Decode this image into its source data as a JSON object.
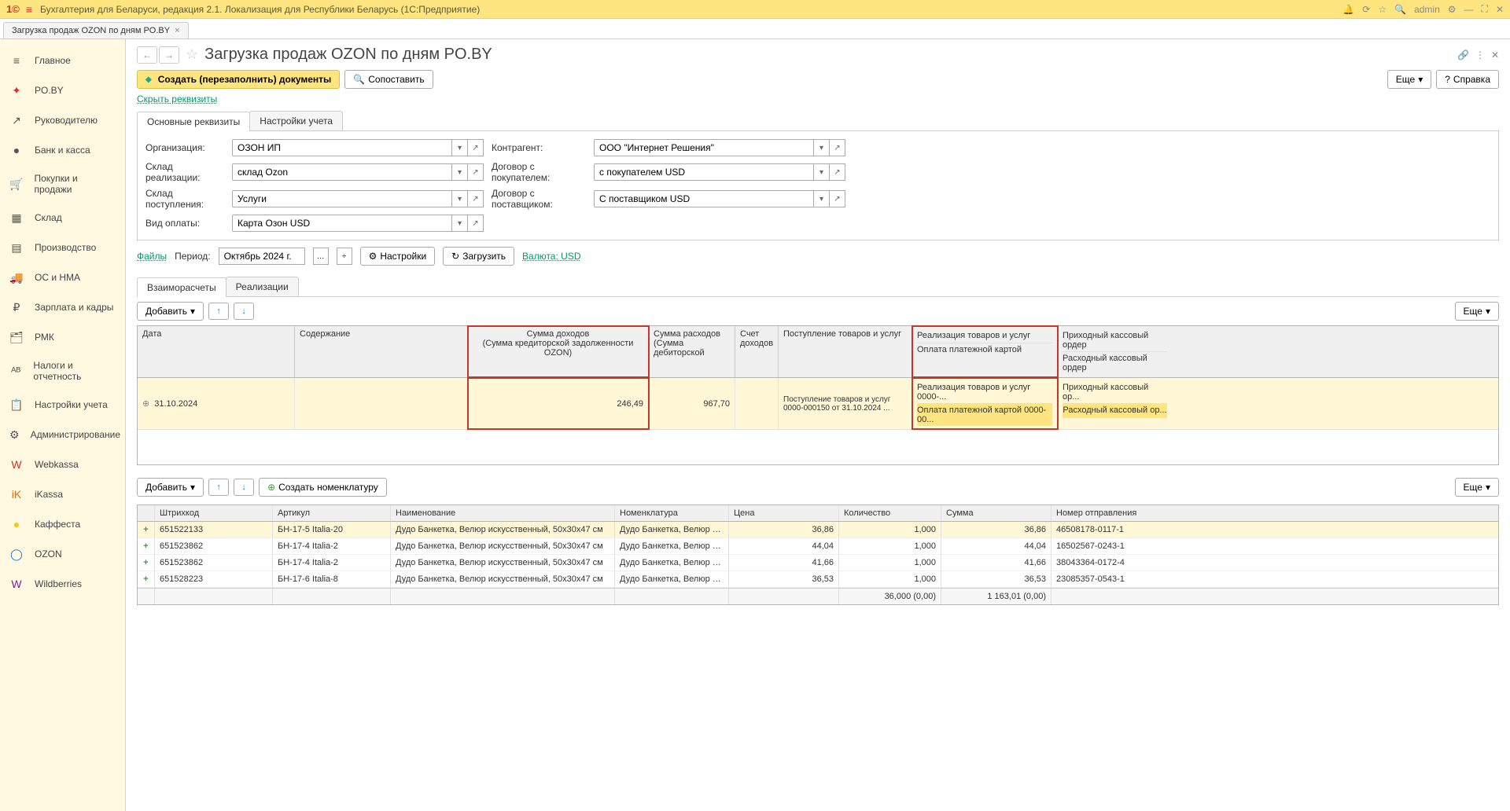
{
  "app": {
    "title": "Бухгалтерия для Беларуси, редакция 2.1. Локализация для Республики Беларусь  (1С:Предприятие)",
    "user": "admin"
  },
  "tab": {
    "label": "Загрузка продаж OZON по дням PO.BY"
  },
  "sidebar": {
    "items": [
      {
        "label": "Главное",
        "icon": "≡",
        "cls": "ic-grey"
      },
      {
        "label": "PO.BY",
        "icon": "✦",
        "cls": "ic-red"
      },
      {
        "label": "Руководителю",
        "icon": "↗",
        "cls": "ic-grey"
      },
      {
        "label": "Банк и касса",
        "icon": "●",
        "cls": "ic-grey"
      },
      {
        "label": "Покупки и продажи",
        "icon": "🛒",
        "cls": "ic-orange"
      },
      {
        "label": "Склад",
        "icon": "▦",
        "cls": "ic-grey"
      },
      {
        "label": "Производство",
        "icon": "▤",
        "cls": "ic-grey"
      },
      {
        "label": "ОС и НМА",
        "icon": "🚚",
        "cls": "ic-grey"
      },
      {
        "label": "Зарплата и кадры",
        "icon": "₽",
        "cls": "ic-grey"
      },
      {
        "label": "РМК",
        "icon": "🗂",
        "cls": "ic-grey"
      },
      {
        "label": "Налоги и отчетность",
        "icon": "ᴬᴮ",
        "cls": "ic-grey"
      },
      {
        "label": "Настройки учета",
        "icon": "📋",
        "cls": "ic-grey"
      },
      {
        "label": "Администрирование",
        "icon": "⚙",
        "cls": "ic-grey"
      },
      {
        "label": "Webkassa",
        "icon": "W",
        "cls": "ic-red"
      },
      {
        "label": "iKassa",
        "icon": "iK",
        "cls": "ic-orange"
      },
      {
        "label": "Каффеста",
        "icon": "●",
        "cls": "ic-yellow"
      },
      {
        "label": "OZON",
        "icon": "◯",
        "cls": "ic-blue"
      },
      {
        "label": "Wildberries",
        "icon": "W",
        "cls": "ic-purple"
      }
    ]
  },
  "page": {
    "title": "Загрузка продаж OZON по дням PO.BY",
    "btn_create": "Создать (перезаполнить) документы",
    "btn_compare": "Сопоставить",
    "btn_more": "Еще",
    "btn_help": "Справка",
    "link_hide": "Скрыть реквизиты"
  },
  "formtabs": {
    "t1": "Основные реквизиты",
    "t2": "Настройки учета"
  },
  "form": {
    "org_label": "Организация:",
    "org_value": "ОЗОН ИП",
    "counter_label": "Контрагент:",
    "counter_value": "ООО \"Интернет Решения\"",
    "whr_label": "Склад реализации:",
    "whr_value": "склад Ozon",
    "buyer_label": "Договор с покупателем:",
    "buyer_value": "с покупателем USD",
    "whi_label": "Склад поступления:",
    "whi_value": "Услуги",
    "supplier_label": "Договор с поставщиком:",
    "supplier_value": "С поставщиком USD",
    "pay_label": "Вид оплаты:",
    "pay_value": "Карта Озон USD"
  },
  "period": {
    "files": "Файлы",
    "label": "Период:",
    "value": "Октябрь 2024 г.",
    "btn_settings": "Настройки",
    "btn_load": "Загрузить",
    "currency": "Валюта: USD"
  },
  "sectabs": {
    "t1": "Взаиморасчеты",
    "t2": "Реализации"
  },
  "tbl_toolbar": {
    "add": "Добавить",
    "create_nom": "Создать номенклатуру",
    "more": "Еще"
  },
  "grid": {
    "head": {
      "date": "Дата",
      "content": "Содержание",
      "income1": "Сумма доходов",
      "income2": "(Сумма кредиторской задолженности OZON)",
      "expense1": "Сумма расходов",
      "expense2": "(Сумма дебиторской",
      "acc": "Счет доходов",
      "recv": "Поступление товаров и услуг",
      "real1": "Реализация товаров и услуг",
      "real2": "Оплата платежной картой",
      "cash1": "Приходный кассовый ордер",
      "cash2": "Расходный кассовый ордер"
    },
    "row": {
      "date": "31.10.2024",
      "income": "246,49",
      "expense": "967,70",
      "recv": "Поступление товаров и услуг 0000-000150 от 31.10.2024 ...",
      "real1": "Реализация товаров и услуг 0000-...",
      "real2": "Оплата платежной картой 0000-00...",
      "cash1": "Приходный кассовый ор...",
      "cash2": "Расходный кассовый ор..."
    }
  },
  "bgrid": {
    "head": {
      "bc": "Штрихкод",
      "art": "Артикул",
      "name": "Наименование",
      "nom": "Номенклатура",
      "price": "Цена",
      "qty": "Количество",
      "sum": "Сумма",
      "ship": "Номер отправления"
    },
    "rows": [
      {
        "bc": "651522133",
        "art": "БН-17-5 Italia-20",
        "name": "Дудо Банкетка, Велюр искусственный, 50x30x47 см",
        "nom": "Дудо Банкетка, Велюр и...",
        "price": "36,86",
        "qty": "1,000",
        "sum": "36,86",
        "ship": "46508178-0117-1"
      },
      {
        "bc": "651523862",
        "art": "БН-17-4 Italia-2",
        "name": "Дудо Банкетка, Велюр искусственный, 50x30x47 см",
        "nom": "Дудо Банкетка, Велюр и...",
        "price": "44,04",
        "qty": "1,000",
        "sum": "44,04",
        "ship": "16502567-0243-1"
      },
      {
        "bc": "651523862",
        "art": "БН-17-4 Italia-2",
        "name": "Дудо Банкетка, Велюр искусственный, 50x30x47 см",
        "nom": "Дудо Банкетка, Велюр и...",
        "price": "41,66",
        "qty": "1,000",
        "sum": "41,66",
        "ship": "38043364-0172-4"
      },
      {
        "bc": "651528223",
        "art": "БН-17-6 Italia-8",
        "name": "Дудо Банкетка, Велюр искусственный, 50x30x47 см",
        "nom": "Дудо Банкетка, Велюр и...",
        "price": "36,53",
        "qty": "1,000",
        "sum": "36,53",
        "ship": "23085357-0543-1"
      }
    ],
    "foot": {
      "qty": "36,000 (0,00)",
      "sum": "1 163,01 (0,00)"
    }
  }
}
